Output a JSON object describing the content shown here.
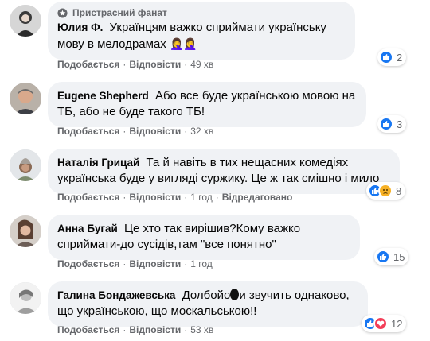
{
  "comments": [
    {
      "badge": "Пристрасний фанат",
      "author": "Юлия Ф.",
      "text": "Українцям важко сприймати українську мову в мелодрамах",
      "emoji": "🤦‍♀️🤦‍♀️",
      "like": "Подобається",
      "reply": "Відповісти",
      "time": "49 хв",
      "reactions": [
        "like"
      ],
      "count": "2"
    },
    {
      "author": "Eugene Shepherd",
      "text": "Або все буде українською мовою на ТБ, або не буде такого ТБ!",
      "like": "Подобається",
      "reply": "Відповісти",
      "time": "32 хв",
      "reactions": [
        "like"
      ],
      "count": "3"
    },
    {
      "author": "Наталія Грицай",
      "text": "Та й навіть в тих нещасних комедіях українська буде у вигляді суржику. Це ж так смішно і мило",
      "like": "Подобається",
      "reply": "Відповісти",
      "time": "1 год",
      "edited": "Відредаговано",
      "reactions": [
        "like",
        "sad"
      ],
      "count": "8"
    },
    {
      "author": "Анна Бугай",
      "text": "Це хто так вирішив?Кому важко сприймати-до сусідів,там \"все понятно\"",
      "like": "Подобається",
      "reply": "Відповісти",
      "time": "1 год",
      "reactions": [
        "like"
      ],
      "count": "15"
    },
    {
      "author": "Галина Бондажевська",
      "text_pre": "Долбойо",
      "text_post": "и звучить однаково, що українською, що москальською!!",
      "like": "Подобається",
      "reply": "Відповісти",
      "time": "53 хв",
      "reactions": [
        "like",
        "love"
      ],
      "count": "12"
    }
  ],
  "colors": {
    "bubble": "#f0f2f5",
    "secondary_text": "#65676b",
    "like_blue": "#1877f2",
    "love_red": "#f33e58",
    "sad_yellow": "#f7b125"
  }
}
